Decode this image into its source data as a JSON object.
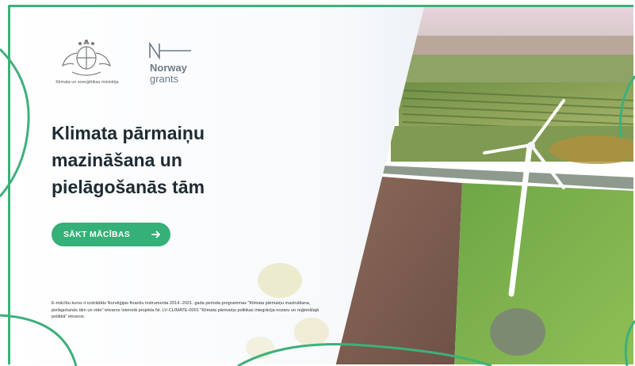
{
  "logos": {
    "ministry_caption": "Klimata un enerģētikas ministrija",
    "norway_label": "Norway",
    "grants_label": "grants"
  },
  "hero": {
    "title_lines": [
      "Klimata pārmaiņu",
      "mazināšana un",
      "pielāgošanās tām"
    ],
    "cta_label": "SĀKT MĀCĪBAS",
    "footnote": "E-mācību kurss ir izstrādāts Norvēģijas finanšu instrumenta 2014.-2021. gada perioda programmas \"Klimata pārmaiņu mazināšana, pielāgošanās tām un vide\" ietvaros īstenotā projekta Nr. LV-CLIMATE-0001 \"Klimata pārmaiņu politikas integrācija nozaru un reģionālajā politikā\" ietvaros."
  },
  "colors": {
    "accent": "#35b077",
    "frame": "#3db07a",
    "title": "#1e2b33"
  },
  "icons": {
    "cta_icon": "arrow-right-icon",
    "ministry_logo": "coat-of-arms-icon",
    "norway_logo": "norway-grants-logo"
  }
}
